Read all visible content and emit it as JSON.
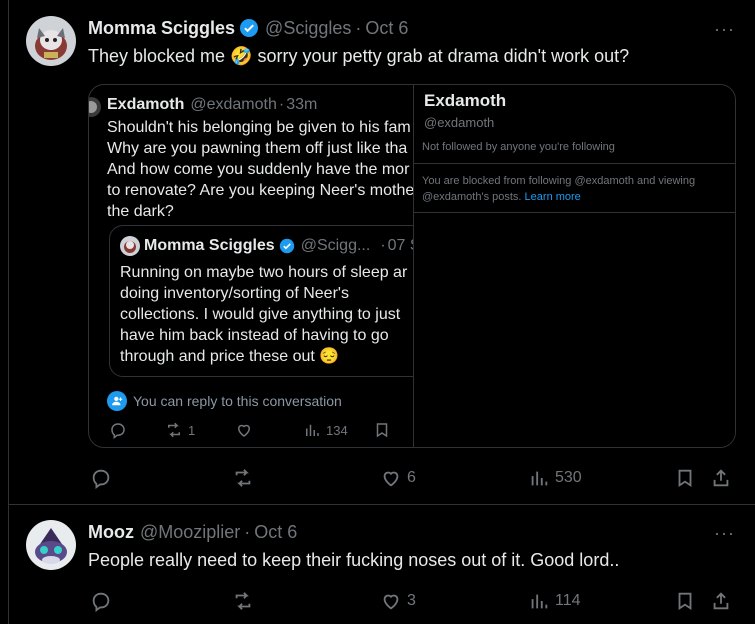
{
  "colors": {
    "background": "#000000",
    "text": "#e7e9ea",
    "muted": "#71767b",
    "accent": "#1d9bf0",
    "border": "#2f3336"
  },
  "tweet1": {
    "name": "Momma Sciggles",
    "handle": "@Sciggles",
    "dot": "·",
    "date": "Oct 6",
    "text_before": "They blocked me",
    "emoji": "🤣",
    "text_after": "sorry your petty grab at drama didn't work out?",
    "more": "···",
    "reply_count": "",
    "retweet_count": "",
    "like_count": "6",
    "view_count": "530",
    "quote": {
      "name": "Exdamoth",
      "handle": "@exdamoth",
      "dot": "·",
      "time": "33m",
      "lines": [
        "Shouldn't his belonging be given to his fam",
        "Why are you pawning them off just like tha",
        "And how come you suddenly have the mor",
        "to renovate? Are you keeping Neer's mothe",
        "the dark?"
      ],
      "nested": {
        "name": "Momma Sciggles",
        "handle": "@Scigg...",
        "dot": "·",
        "date": "07 S",
        "lines": [
          "Running on maybe two hours of sleep ar",
          "doing inventory/sorting of Neer's",
          "collections. I would give anything to just",
          "have him back instead of having to go",
          "through and price these out 😔"
        ]
      },
      "reply_note": "You can reply to this conversation",
      "retweet_count": "1",
      "view_count": "134"
    },
    "hovercard": {
      "name": "Exdamoth",
      "handle": "@exdamoth",
      "follow_status": "Not followed by anyone you're following",
      "blocked_line1": "You are blocked from following @exdamoth and viewing",
      "blocked_line2": "@exdamoth's posts.",
      "learn_more": "Learn more"
    }
  },
  "tweet2": {
    "name": "Mooz",
    "handle": "@Mooziplier",
    "dot": "·",
    "date": "Oct 6",
    "text": "People really need to keep their fucking noses out of it. Good lord..",
    "more": "···",
    "like_count": "3",
    "view_count": "114"
  }
}
